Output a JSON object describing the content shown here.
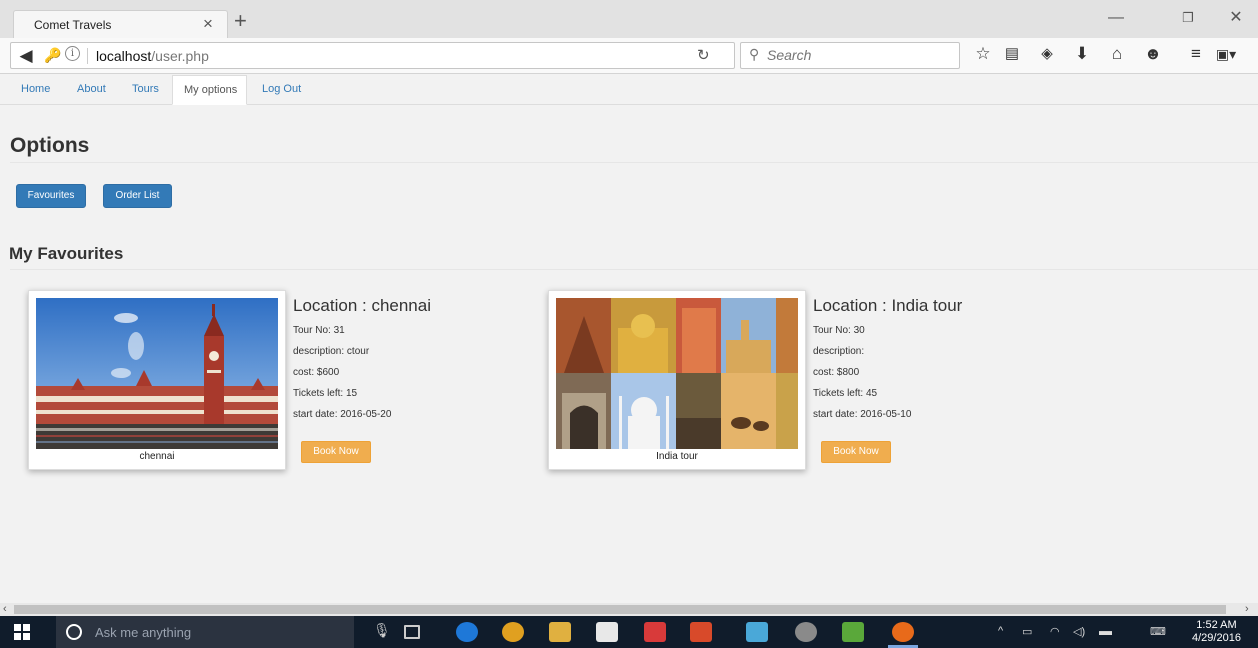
{
  "browser": {
    "tab_title": "Comet Travels",
    "tab_close": "×",
    "new_tab": "+",
    "url_host": "localhost",
    "url_path": "/user.php",
    "search_placeholder": "Search"
  },
  "site_nav": [
    "Home",
    "About",
    "Tours",
    "My options",
    "Log Out"
  ],
  "page": {
    "title": "Options",
    "buttons": [
      "Favourites",
      "Order List"
    ],
    "section_title": "My Favourites"
  },
  "favourites": [
    {
      "caption": "chennai",
      "location": "Location : chennai",
      "tour_no": "Tour No: 31",
      "description": "description: ctour",
      "cost": "cost: $600",
      "tickets_left": "Tickets left: 15",
      "start_date": "start date: 2016-05-20",
      "book_label": "Book Now"
    },
    {
      "caption": "India tour",
      "location": "Location : India tour",
      "tour_no": "Tour No: 30",
      "description": "description:",
      "cost": "cost: $800",
      "tickets_left": "Tickets left: 45",
      "start_date": "start date: 2016-05-10",
      "book_label": "Book Now"
    }
  ],
  "taskbar": {
    "search_text": "Ask me anything",
    "time": "1:52 AM",
    "date": "4/29/2016"
  },
  "icons": {
    "back": "back-arrow-icon",
    "search": "search-icon",
    "reload": "reload-icon",
    "toolbar": [
      "bookmark-star-icon",
      "reading-list-icon",
      "pocket-icon",
      "download-icon",
      "home-icon",
      "chat-icon",
      "menu-icon",
      "extension-icon"
    ]
  },
  "colors": {
    "primary_button": "#337ab7",
    "book_button": "#f0ad4e",
    "link": "#337ab7",
    "taskbar": "#101c2b"
  }
}
